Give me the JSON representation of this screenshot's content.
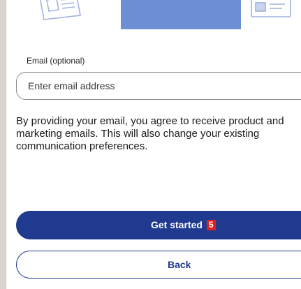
{
  "form": {
    "email_label": "Email (optional)",
    "email_placeholder": "Enter email address",
    "email_value": "",
    "consent_text": "By providing your email, you agree to receive product and marketing emails. This will also change your existing communication preferences."
  },
  "actions": {
    "primary_label": "Get started",
    "primary_badge": "5",
    "secondary_label": "Back"
  },
  "colors": {
    "primary": "#1f3a8f",
    "badge": "#e02020",
    "illustration_accent": "#6f8fd4"
  },
  "icons": {
    "left_illustration": "document-icon",
    "right_illustration": "id-card-icon"
  }
}
